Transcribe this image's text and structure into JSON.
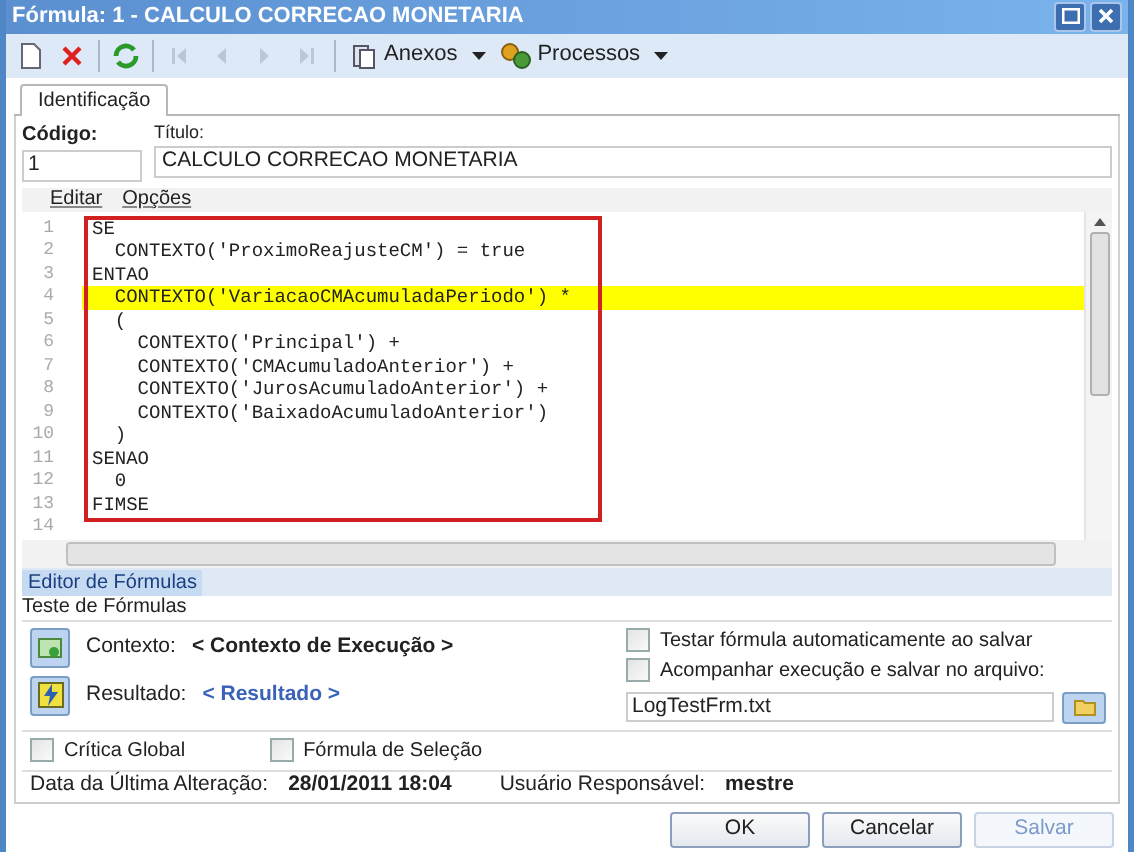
{
  "window": {
    "title": "Fórmula: 1 - CALCULO CORRECAO MONETARIA"
  },
  "toolbar": {
    "buttons": [
      {
        "kind": "new",
        "disabled": false
      },
      {
        "kind": "delete",
        "disabled": false
      },
      {
        "kind": "refresh",
        "disabled": false
      },
      {
        "kind": "first",
        "disabled": true
      },
      {
        "kind": "prev",
        "disabled": true
      },
      {
        "kind": "next",
        "disabled": true
      },
      {
        "kind": "last",
        "disabled": true
      }
    ],
    "menus": [
      {
        "kind": "attach",
        "label": "Anexos"
      },
      {
        "kind": "process",
        "label": "Processos"
      }
    ]
  },
  "tabs": [
    {
      "label": "Identificação",
      "selected": true
    }
  ],
  "form": {
    "code": {
      "label": "Código:",
      "value": "1"
    },
    "title": {
      "label": "Título:",
      "value": "CALCULO CORRECAO MONETARIA"
    }
  },
  "editor": {
    "menu": [
      "Editar",
      "Opções"
    ],
    "lines": [
      {
        "number": "1",
        "code": "SE",
        "highlighted": false
      },
      {
        "number": "2",
        "code": "  CONTEXTO('ProximoReajusteCM') = true",
        "highlighted": false
      },
      {
        "number": "3",
        "code": "ENTAO",
        "highlighted": false
      },
      {
        "number": "4",
        "code": "  CONTEXTO('VariacaoCMAcumuladaPeriodo') *",
        "highlighted": true
      },
      {
        "number": "5",
        "code": "  (",
        "highlighted": false
      },
      {
        "number": "6",
        "code": "    CONTEXTO('Principal') +",
        "highlighted": false
      },
      {
        "number": "7",
        "code": "    CONTEXTO('CMAcumuladoAnterior') +",
        "highlighted": false
      },
      {
        "number": "8",
        "code": "    CONTEXTO('JurosAcumuladoAnterior') +",
        "highlighted": false
      },
      {
        "number": "9",
        "code": "    CONTEXTO('BaixadoAcumuladoAnterior')",
        "highlighted": false
      },
      {
        "number": "10",
        "code": "  )",
        "highlighted": false
      },
      {
        "number": "11",
        "code": "SENAO",
        "highlighted": false
      },
      {
        "number": "12",
        "code": "  0",
        "highlighted": false
      },
      {
        "number": "13",
        "code": "FIMSE",
        "highlighted": false
      },
      {
        "number": "14"
      }
    ],
    "bottom_tab": {
      "label": "Editor de Fórmulas",
      "selected": true
    }
  },
  "test": {
    "title": "Teste de Fórmulas",
    "context": {
      "label": "Contexto:",
      "value": "< Contexto de Execução >"
    },
    "result": {
      "label": "Resultado:",
      "value": "< Resultado >"
    },
    "options": [
      {
        "label": "Testar fórmula automaticamente ao salvar",
        "checked": false
      },
      {
        "label": "Acompanhar execução e salvar no arquivo:",
        "checked": false
      }
    ],
    "file": {
      "value": "LogTestFrm.txt"
    }
  },
  "flags": [
    {
      "label": "Crítica Global",
      "checked": false
    },
    {
      "label": "Fórmula de Seleção",
      "checked": false
    }
  ],
  "info": {
    "date_label": "Data da Última Alteração:",
    "date": "28/01/2011 18:04",
    "user_label": "Usuário Responsável:",
    "user": "mestre"
  },
  "buttons": [
    {
      "label": "OK",
      "disabled": false
    },
    {
      "label": "Cancelar",
      "disabled": false
    },
    {
      "label": "Salvar",
      "disabled": true
    }
  ]
}
